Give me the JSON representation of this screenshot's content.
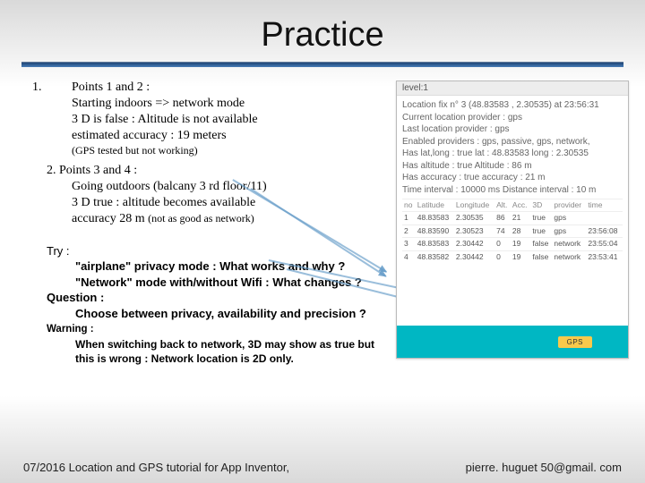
{
  "title": "Practice",
  "point1": {
    "num": "1.",
    "heading": "Points 1 and 2 :",
    "l1": "Starting indoors  => network mode",
    "l2": "3 D is false : Altitude is not available",
    "l3": "estimated accuracy : 19 meters",
    "note": "(GPS tested but not working)"
  },
  "point2": {
    "heading": "2. Points 3 and 4 :",
    "l1": "Going outdoors (balcany 3 rd floor/11)",
    "l2": "3 D true : altitude becomes available",
    "l3a": "accuracy 28 m ",
    "l3b": "(not as good as network)"
  },
  "tryHead": "Try  :",
  "try1": "\"airplane\" privacy mode : What works and why ?",
  "try2": "\"Network\" mode with/without Wifi : What changes ?",
  "qHead": "Question :",
  "q1": "Choose between privacy, availability and precision ?",
  "wHead": "Warning :",
  "w1": "When switching back to network, 3D may show as true but",
  "w2": "this is wrong : Network location is 2D only.",
  "footerLeft": "07/2016   Location and GPS tutorial for App Inventor,",
  "footerRight": "pierre. huguet 50@gmail. com",
  "phone": {
    "header": "level:1",
    "r1": "Location fix n° 3 (48.83583 , 2.30535) at 23:56:31",
    "r2": "Current location provider : gps",
    "r3": "Last location provider        : gps",
    "r4": "Enabled providers : gps, passive, gps, network,",
    "r5": "Has lat,long : true  lat : 48.83583 long : 2.30535",
    "r6": "Has altitude : true  Altitude : 86 m",
    "r7": "Has accuracy : true    accuracy : 21 m",
    "r8": "Time interval : 10000 ms  Distance interval : 10 m",
    "cols": [
      "no",
      "Latitude",
      "Longitude",
      "Alt.",
      "Acc.",
      "3D",
      "provider",
      "time"
    ],
    "rows": [
      [
        "1",
        "48.83583",
        "2.30535",
        "86",
        "21",
        "true",
        "gps",
        ""
      ],
      [
        "2",
        "48.83590",
        "2.30523",
        "74",
        "28",
        "true",
        "gps",
        "23:56:08"
      ],
      [
        "3",
        "48.83583",
        "2.30442",
        "0",
        "19",
        "false",
        "network",
        "23:55:04"
      ],
      [
        "4",
        "48.83582",
        "2.30442",
        "0",
        "19",
        "false",
        "network",
        "23:53:41"
      ]
    ],
    "chip": "GPS"
  }
}
